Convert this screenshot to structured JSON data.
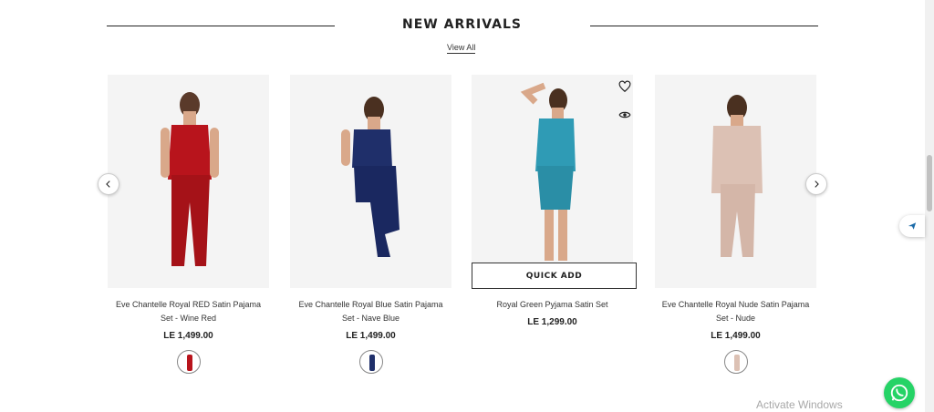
{
  "section": {
    "title": "NEW ARRIVALS",
    "view_all": "View All"
  },
  "products": [
    {
      "title": "Eve Chantelle Royal RED Satin Pajama Set - Wine Red",
      "price": "LE 1,499.00",
      "color": "#b8141c",
      "swatch_color": "#b8141c"
    },
    {
      "title": "Eve Chantelle Royal Blue Satin Pajama Set - Nave Blue",
      "price": "LE 1,499.00",
      "color": "#1f2f6a",
      "swatch_color": "#1f2f6a"
    },
    {
      "title": "Royal Green Pyjama Satin Set",
      "price": "LE 1,299.00",
      "color": "#2f9bb5",
      "quick_add": "QUICK ADD"
    },
    {
      "title": "Eve Chantelle Royal Nude Satin Pajama Set - Nude",
      "price": "LE 1,499.00",
      "color": "#dcc1b4",
      "swatch_color": "#dcc1b4"
    }
  ],
  "icons": {
    "wishlist": "heart-icon",
    "quick_view": "eye-icon",
    "prev": "chevron-left-icon",
    "next": "chevron-right-icon",
    "whatsapp": "whatsapp-icon",
    "float": "paper-plane-icon"
  },
  "watermark": "Activate Windows",
  "colors": {
    "whatsapp": "#25d366",
    "text": "#222222"
  }
}
